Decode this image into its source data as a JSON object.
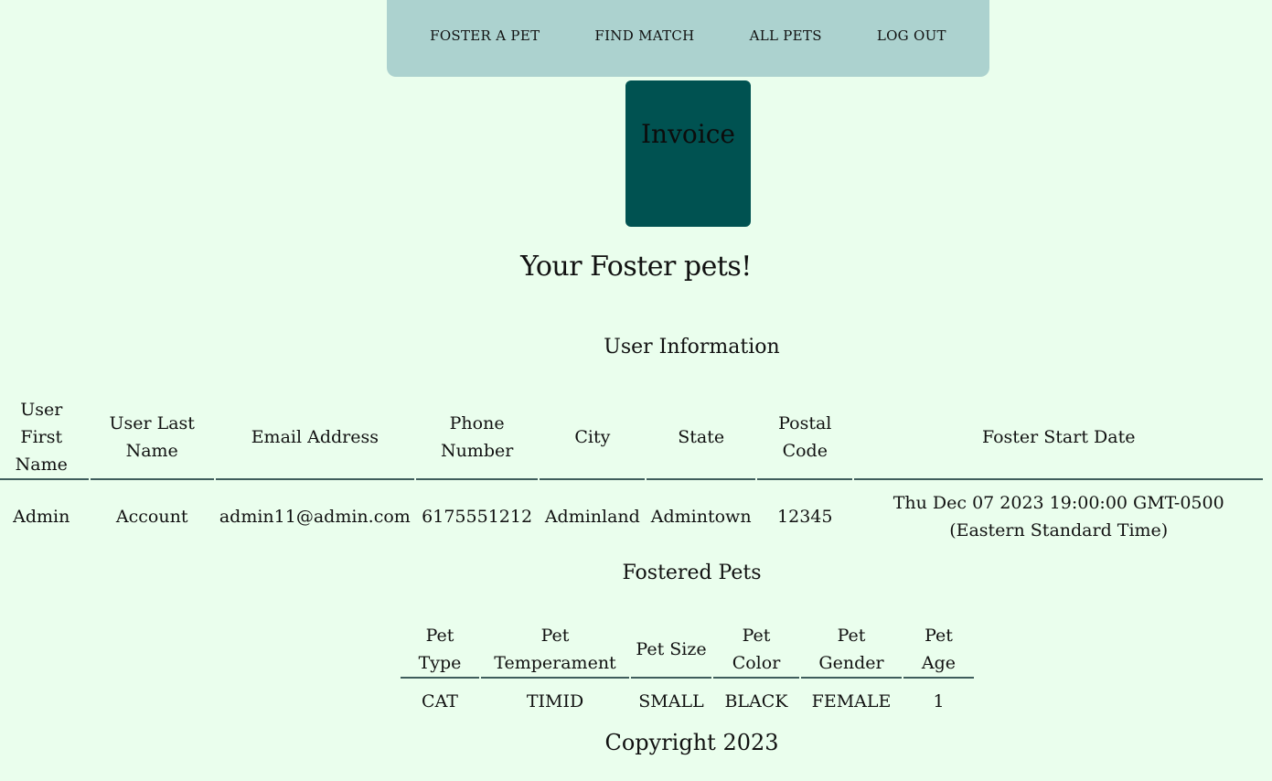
{
  "nav": {
    "items": [
      "FOSTER A PET",
      "FIND MATCH",
      "ALL PETS",
      "LOG OUT"
    ]
  },
  "invoice": {
    "label": "Invoice"
  },
  "heading": "Your Foster pets!",
  "user_section": {
    "title": "User Information",
    "headers": [
      "User First Name",
      "User Last Name",
      "Email Address",
      "Phone Number",
      "City",
      "State",
      "Postal Code",
      "Foster Start Date"
    ],
    "row": [
      "Admin",
      "Account",
      "admin11@admin.com",
      "6175551212",
      "Adminland",
      "Admintown",
      "12345",
      "Thu Dec 07 2023 19:00:00 GMT-0500 (Eastern Standard Time)"
    ]
  },
  "pets_section": {
    "title": "Fostered Pets",
    "headers": [
      "Pet Type",
      "Pet Temperament",
      "Pet Size",
      "Pet Color",
      "Pet Gender",
      "Pet Age"
    ],
    "row": [
      "CAT",
      "TIMID",
      "SMALL",
      "BLACK",
      "FEMALE",
      "1"
    ]
  },
  "footer": "Copyright 2023",
  "colors": {
    "background": "#eafeed",
    "navbar": "#acd2cf",
    "invoice_button": "#005251",
    "table_rule": "#3f5d5c"
  }
}
